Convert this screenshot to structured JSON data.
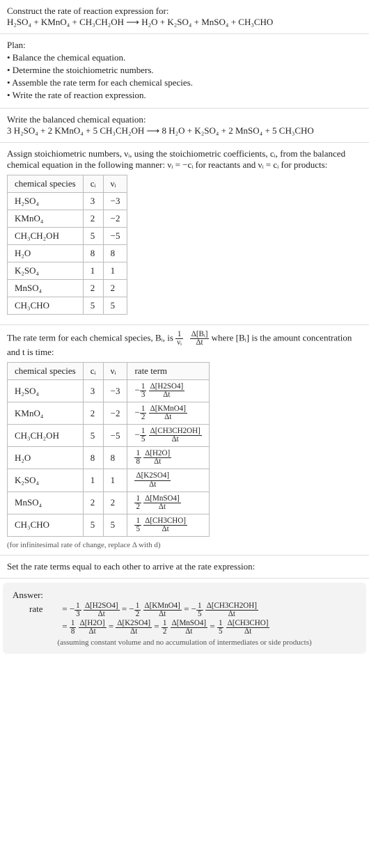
{
  "prompt": {
    "title": "Construct the rate of reaction expression for:",
    "equation": "H₂SO₄ + KMnO₄ + CH₃CH₂OH ⟶ H₂O + K₂SO₄ + MnSO₄ + CH₃CHO"
  },
  "plan": {
    "heading": "Plan:",
    "items": [
      "• Balance the chemical equation.",
      "• Determine the stoichiometric numbers.",
      "• Assemble the rate term for each chemical species.",
      "• Write the rate of reaction expression."
    ]
  },
  "balanced": {
    "heading": "Write the balanced chemical equation:",
    "equation": "3 H₂SO₄ + 2 KMnO₄ + 5 CH₃CH₂OH ⟶ 8 H₂O + K₂SO₄ + 2 MnSO₄ + 5 CH₃CHO"
  },
  "stoich": {
    "intro_a": "Assign stoichiometric numbers, νᵢ, using the stoichiometric coefficients, cᵢ, from the balanced chemical equation in the following manner: νᵢ = −cᵢ for reactants and νᵢ = cᵢ for products:",
    "headers": [
      "chemical species",
      "cᵢ",
      "νᵢ"
    ],
    "rows": [
      [
        "H₂SO₄",
        "3",
        "−3"
      ],
      [
        "KMnO₄",
        "2",
        "−2"
      ],
      [
        "CH₃CH₂OH",
        "5",
        "−5"
      ],
      [
        "H₂O",
        "8",
        "8"
      ],
      [
        "K₂SO₄",
        "1",
        "1"
      ],
      [
        "MnSO₄",
        "2",
        "2"
      ],
      [
        "CH₃CHO",
        "5",
        "5"
      ]
    ]
  },
  "rate_term_intro": {
    "before": "The rate term for each chemical species, Bᵢ, is ",
    "after": " where [Bᵢ] is the amount concentration and t is time:",
    "frac_outer_num": "1",
    "frac_outer_den": "νᵢ",
    "frac_inner_num": "Δ[Bᵢ]",
    "frac_inner_den": "Δt"
  },
  "rate_table": {
    "headers": [
      "chemical species",
      "cᵢ",
      "νᵢ",
      "rate term"
    ],
    "rows": [
      {
        "sp": "H₂SO₄",
        "c": "3",
        "v": "−3",
        "sign": "−",
        "coef_num": "1",
        "coef_den": "3",
        "d_num": "Δ[H2SO4]",
        "d_den": "Δt"
      },
      {
        "sp": "KMnO₄",
        "c": "2",
        "v": "−2",
        "sign": "−",
        "coef_num": "1",
        "coef_den": "2",
        "d_num": "Δ[KMnO4]",
        "d_den": "Δt"
      },
      {
        "sp": "CH₃CH₂OH",
        "c": "5",
        "v": "−5",
        "sign": "−",
        "coef_num": "1",
        "coef_den": "5",
        "d_num": "Δ[CH3CH2OH]",
        "d_den": "Δt"
      },
      {
        "sp": "H₂O",
        "c": "8",
        "v": "8",
        "sign": "",
        "coef_num": "1",
        "coef_den": "8",
        "d_num": "Δ[H2O]",
        "d_den": "Δt"
      },
      {
        "sp": "K₂SO₄",
        "c": "1",
        "v": "1",
        "sign": "",
        "coef_num": "",
        "coef_den": "",
        "d_num": "Δ[K2SO4]",
        "d_den": "Δt"
      },
      {
        "sp": "MnSO₄",
        "c": "2",
        "v": "2",
        "sign": "",
        "coef_num": "1",
        "coef_den": "2",
        "d_num": "Δ[MnSO4]",
        "d_den": "Δt"
      },
      {
        "sp": "CH₃CHO",
        "c": "5",
        "v": "5",
        "sign": "",
        "coef_num": "1",
        "coef_den": "5",
        "d_num": "Δ[CH3CHO]",
        "d_den": "Δt"
      }
    ],
    "footnote": "(for infinitesimal rate of change, replace Δ with d)"
  },
  "final": {
    "lead": "Set the rate terms equal to each other to arrive at the rate expression:",
    "answer_label": "Answer:",
    "rate_label": "rate",
    "line1": [
      {
        "pre": "= −",
        "cn": "1",
        "cd": "3",
        "dn": "Δ[H2SO4]",
        "dd": "Δt"
      },
      {
        "pre": " = −",
        "cn": "1",
        "cd": "2",
        "dn": "Δ[KMnO4]",
        "dd": "Δt"
      },
      {
        "pre": " = −",
        "cn": "1",
        "cd": "5",
        "dn": "Δ[CH3CH2OH]",
        "dd": "Δt"
      }
    ],
    "line2": [
      {
        "pre": "= ",
        "cn": "1",
        "cd": "8",
        "dn": "Δ[H2O]",
        "dd": "Δt"
      },
      {
        "pre": " = ",
        "cn": "",
        "cd": "",
        "dn": "Δ[K2SO4]",
        "dd": "Δt"
      },
      {
        "pre": " = ",
        "cn": "1",
        "cd": "2",
        "dn": "Δ[MnSO4]",
        "dd": "Δt"
      },
      {
        "pre": " = ",
        "cn": "1",
        "cd": "5",
        "dn": "Δ[CH3CHO]",
        "dd": "Δt"
      }
    ],
    "assumption": "(assuming constant volume and no accumulation of intermediates or side products)"
  },
  "chart_data": {
    "type": "table",
    "title": "Stoichiometric numbers and rate terms",
    "stoichiometric_table": {
      "columns": [
        "chemical species",
        "c_i",
        "ν_i"
      ],
      "rows": [
        [
          "H2SO4",
          3,
          -3
        ],
        [
          "KMnO4",
          2,
          -2
        ],
        [
          "CH3CH2OH",
          5,
          -5
        ],
        [
          "H2O",
          8,
          8
        ],
        [
          "K2SO4",
          1,
          1
        ],
        [
          "MnSO4",
          2,
          2
        ],
        [
          "CH3CHO",
          5,
          5
        ]
      ]
    },
    "rate_term_table": {
      "columns": [
        "chemical species",
        "c_i",
        "ν_i",
        "rate term"
      ],
      "rows": [
        [
          "H2SO4",
          3,
          -3,
          "-(1/3) Δ[H2SO4]/Δt"
        ],
        [
          "KMnO4",
          2,
          -2,
          "-(1/2) Δ[KMnO4]/Δt"
        ],
        [
          "CH3CH2OH",
          5,
          -5,
          "-(1/5) Δ[CH3CH2OH]/Δt"
        ],
        [
          "H2O",
          8,
          8,
          "(1/8) Δ[H2O]/Δt"
        ],
        [
          "K2SO4",
          1,
          1,
          "Δ[K2SO4]/Δt"
        ],
        [
          "MnSO4",
          2,
          2,
          "(1/2) Δ[MnSO4]/Δt"
        ],
        [
          "CH3CHO",
          5,
          5,
          "(1/5) Δ[CH3CHO]/Δt"
        ]
      ]
    },
    "balanced_equation": "3 H2SO4 + 2 KMnO4 + 5 CH3CH2OH -> 8 H2O + K2SO4 + 2 MnSO4 + 5 CH3CHO",
    "rate_expression": "rate = -(1/3) Δ[H2SO4]/Δt = -(1/2) Δ[KMnO4]/Δt = -(1/5) Δ[CH3CH2OH]/Δt = (1/8) Δ[H2O]/Δt = Δ[K2SO4]/Δt = (1/2) Δ[MnSO4]/Δt = (1/5) Δ[CH3CHO]/Δt"
  }
}
